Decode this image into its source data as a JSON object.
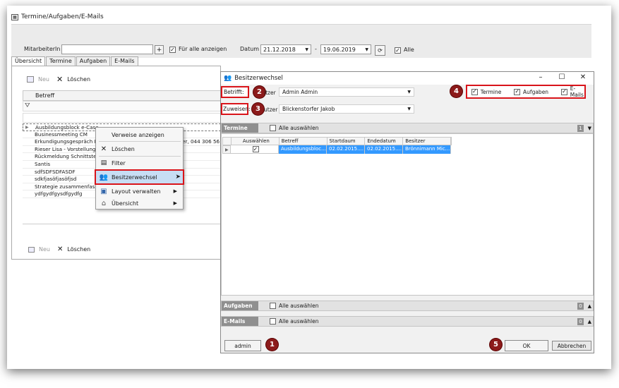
{
  "window": {
    "title": "Termine/Aufgaben/E-Mails"
  },
  "filter": {
    "employee_label": "MitarbeiterIn",
    "employee_value": "",
    "add_label": "+",
    "show_all_label": "Für alle anzeigen",
    "date_label": "Datum",
    "date_from": "21.12.2018",
    "date_separator": "-",
    "date_to": "19.06.2019",
    "all_label": "Alle"
  },
  "tabs": [
    "Übersicht",
    "Termine",
    "Aufgaben",
    "E-Mails"
  ],
  "left": {
    "new_label": "Neu",
    "delete_label": "Löschen",
    "column_header": "Betreff",
    "rows": [
      "Ausbildungsblock e-Case",
      "Businessmeeting CM",
      "Erkundigungsgespräch H",
      "Rieser Lisa - Vorstellungs",
      "Rückmeldung Schnittstell",
      "Santis",
      "sdfSDFSDFASDF",
      "sdkfjasöfjasöfjsd",
      "Strategie zusammenfass",
      "ydfgydfgysdfgydfg"
    ],
    "row_extra": "er, 044 306 56",
    "bottom_new_label": "Neu",
    "bottom_delete_label": "Löschen"
  },
  "context_menu": {
    "items": [
      {
        "label": "Verweise anzeigen",
        "icon": "none",
        "submenu": false
      },
      {
        "label": "Löschen",
        "icon": "delete-x-icon",
        "submenu": false
      },
      {
        "label": "Filter",
        "icon": "filter-icon",
        "submenu": false
      },
      {
        "label": "Besitzerwechsel",
        "icon": "owner-change-icon",
        "submenu": false,
        "highlighted": true
      },
      {
        "label": "Layout verwalten",
        "icon": "layout-icon",
        "submenu": true
      },
      {
        "label": "Übersicht",
        "icon": "overview-icon",
        "submenu": true
      }
    ],
    "arrow": "▶"
  },
  "dialog": {
    "title": "Besitzerwechsel",
    "affects_label": "Betrifft:",
    "affects_user_label": "itzer",
    "affects_user": "Admin Admin",
    "assign_label": "Zuweisen:",
    "assign_user_label": "utzer",
    "assign_user": "Blickenstorfer Jakob",
    "type_filters": [
      {
        "label": "Termine",
        "checked": true
      },
      {
        "label": "Aufgaben",
        "checked": true
      },
      {
        "label": "E-Mails",
        "checked": true
      }
    ],
    "sections": {
      "termine": {
        "label": "Termine",
        "select_all": "Alle auswählen",
        "count": "1"
      },
      "aufgaben": {
        "label": "Aufgaben",
        "select_all": "Alle auswählen",
        "count": "0"
      },
      "emails": {
        "label": "E-Mails",
        "select_all": "Alle auswählen",
        "count": "0"
      }
    },
    "grid": {
      "headers": [
        "Auswählen",
        "Betreff",
        "Startdaum",
        "Endedatum",
        "Besitzer"
      ],
      "row": {
        "selected": true,
        "betreff": "Ausbildungsbloc...",
        "start": "02.02.2015....",
        "end": "02.02.2015....",
        "owner": "Brönnimann Mic..."
      }
    },
    "admin_button": "admin",
    "ok_button": "OK",
    "cancel_button": "Abbrechen"
  },
  "badges": [
    "1",
    "2",
    "3",
    "4",
    "5"
  ],
  "colors": {
    "highlight_red": "#d9141a",
    "badge": "#8c1a1a",
    "selection_blue": "#3399ff"
  }
}
